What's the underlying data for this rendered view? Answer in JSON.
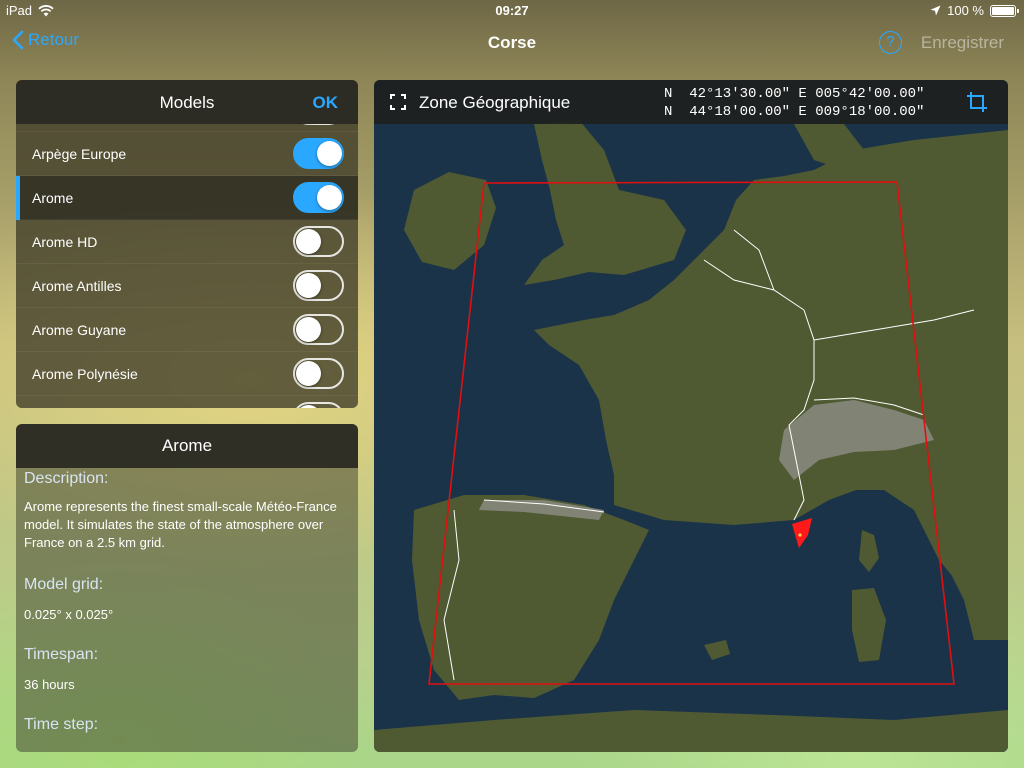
{
  "status_bar": {
    "device": "iPad",
    "time": "09:27",
    "battery": "100 %",
    "battery_level": 1.0,
    "icons": [
      "wifi-icon",
      "location-arrow-icon",
      "battery-icon"
    ]
  },
  "nav": {
    "back_label": "Retour",
    "title": "Corse",
    "help_label": "?",
    "save_label": "Enregistrer"
  },
  "models": {
    "title": "Models",
    "ok_label": "OK",
    "items": [
      {
        "name": "Arpège Europe",
        "on": true,
        "selected": false
      },
      {
        "name": "Arome",
        "on": true,
        "selected": true
      },
      {
        "name": "Arome HD",
        "on": false,
        "selected": false
      },
      {
        "name": "Arome Antilles",
        "on": false,
        "selected": false
      },
      {
        "name": "Arome Guyane",
        "on": false,
        "selected": false
      },
      {
        "name": "Arome Polynésie",
        "on": false,
        "selected": false
      }
    ]
  },
  "info": {
    "title": "Arome",
    "description_label": "Description:",
    "description": "Arome represents the finest small-scale Météo-France model. It simulates the state of the atmosphere over France on a 2.5 km grid.",
    "grid_label": "Model grid:",
    "grid": "0.025° x 0.025°",
    "timespan_label": "Timespan:",
    "timespan": "36 hours",
    "timestep_label": "Time step:"
  },
  "map": {
    "zone_label": "Zone Géographique",
    "coords_line1": "N  42°13'30.00\" E 005°42'00.00\"",
    "coords_line2": "N  44°18'00.00\" E 009°18'00.00\"",
    "colors": {
      "sea": "#1b3348",
      "land": "#4f5a32",
      "mountains": "#8d8f86",
      "borders": "#ffffff",
      "domain_outline": "#e01010",
      "selection": "#ff1a1a",
      "accent": "#2aa8ff"
    }
  }
}
